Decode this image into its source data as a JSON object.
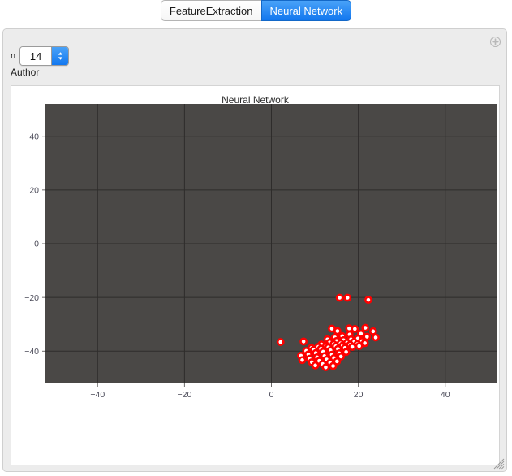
{
  "tabs": [
    {
      "label": "FeatureExtraction",
      "active": false
    },
    {
      "label": "Neural Network",
      "active": true
    }
  ],
  "controls": {
    "n_label": "n",
    "n_value": "14",
    "author_label": "Author",
    "plus_icon": "plus-circle-icon"
  },
  "window": {
    "resize_grip_icon": "resize-grip-icon"
  },
  "chart_data": {
    "type": "scatter",
    "title": "Neural Network",
    "xlabel": "",
    "ylabel": "",
    "xlim": [
      -52,
      52
    ],
    "ylim": [
      -52,
      52
    ],
    "xticks": [
      -40,
      -20,
      0,
      20,
      40
    ],
    "yticks": [
      -40,
      -20,
      0,
      20,
      40
    ],
    "xtick_labels": [
      "-40",
      "-20",
      "0",
      "20",
      "40"
    ],
    "ytick_labels": [
      "-40",
      "-20",
      "0",
      "20",
      "40"
    ],
    "grid": true,
    "background": "#4a4846",
    "grid_color": "#2e2c2b",
    "point_color": "#ff0000",
    "point_fill": "#ffffff",
    "point_radius": 3.6,
    "legend": null,
    "series": [
      {
        "name": "points",
        "points": [
          [
            15.7,
            -20.1
          ],
          [
            17.5,
            -20.1
          ],
          [
            22.3,
            -20.9
          ],
          [
            2.1,
            -36.6
          ],
          [
            7.4,
            -36.4
          ],
          [
            13.9,
            -31.6
          ],
          [
            15.2,
            -32.5
          ],
          [
            17.9,
            -31.5
          ],
          [
            19.2,
            -31.7
          ],
          [
            21.6,
            -31.3
          ],
          [
            23.4,
            -32.6
          ],
          [
            20.6,
            -33.5
          ],
          [
            18.0,
            -33.8
          ],
          [
            16.3,
            -34.4
          ],
          [
            14.6,
            -34.9
          ],
          [
            12.9,
            -35.6
          ],
          [
            22.0,
            -34.6
          ],
          [
            24.0,
            -34.9
          ],
          [
            19.9,
            -35.3
          ],
          [
            18.3,
            -35.6
          ],
          [
            16.6,
            -35.9
          ],
          [
            15.0,
            -36.2
          ],
          [
            13.4,
            -36.8
          ],
          [
            11.5,
            -37.5
          ],
          [
            20.8,
            -36.3
          ],
          [
            19.0,
            -36.6
          ],
          [
            17.4,
            -36.9
          ],
          [
            15.9,
            -37.1
          ],
          [
            14.3,
            -37.4
          ],
          [
            12.6,
            -37.9
          ],
          [
            10.8,
            -38.4
          ],
          [
            9.2,
            -38.8
          ],
          [
            21.5,
            -37.0
          ],
          [
            19.8,
            -37.3
          ],
          [
            18.1,
            -37.6
          ],
          [
            16.4,
            -37.9
          ],
          [
            14.8,
            -38.2
          ],
          [
            13.1,
            -38.6
          ],
          [
            11.4,
            -39.1
          ],
          [
            9.7,
            -39.5
          ],
          [
            8.0,
            -39.9
          ],
          [
            20.2,
            -38.1
          ],
          [
            18.6,
            -38.4
          ],
          [
            16.9,
            -38.8
          ],
          [
            15.3,
            -39.2
          ],
          [
            13.6,
            -39.7
          ],
          [
            11.9,
            -40.2
          ],
          [
            10.2,
            -40.7
          ],
          [
            8.5,
            -41.2
          ],
          [
            6.8,
            -41.7
          ],
          [
            17.2,
            -40.3
          ],
          [
            15.6,
            -40.8
          ],
          [
            13.9,
            -41.3
          ],
          [
            12.2,
            -41.8
          ],
          [
            10.5,
            -42.3
          ],
          [
            8.8,
            -42.8
          ],
          [
            7.1,
            -43.3
          ],
          [
            16.0,
            -42.0
          ],
          [
            14.4,
            -42.6
          ],
          [
            12.7,
            -43.1
          ],
          [
            11.0,
            -43.6
          ],
          [
            9.3,
            -44.1
          ],
          [
            15.1,
            -43.8
          ],
          [
            13.5,
            -44.3
          ],
          [
            11.8,
            -44.8
          ],
          [
            10.1,
            -45.3
          ],
          [
            14.2,
            -45.5
          ],
          [
            12.5,
            -46.0
          ]
        ]
      }
    ]
  }
}
